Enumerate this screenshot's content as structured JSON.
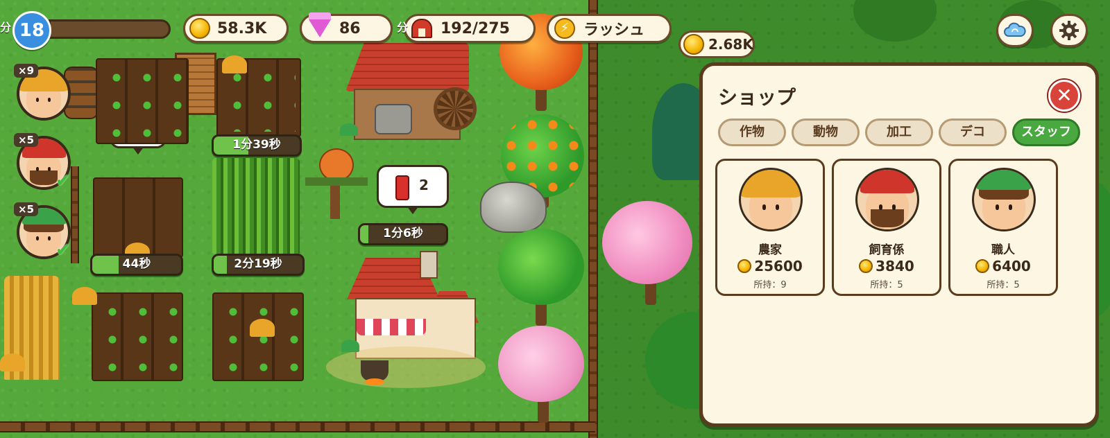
{
  "hud": {
    "level": "18",
    "coins": "58.3K",
    "gems": "86",
    "barn_capacity": "192/275",
    "rush_label": "ラッシュ",
    "cloud_icon": "cloud-sync-icon",
    "settings_icon": "gear-icon"
  },
  "farm": {
    "timers": [
      {
        "label": "1分39秒",
        "progress": 0.4
      },
      {
        "label": "1分6秒",
        "progress": 0.1
      },
      {
        "label": "44秒",
        "progress": 0.3
      },
      {
        "label": "2分19秒",
        "progress": 0.15
      }
    ],
    "sauce_bubble_count": "2",
    "floating_coin": "2.68K",
    "left_edge_text_1": "分",
    "left_edge_text_2": "分"
  },
  "staff_list": [
    {
      "count": "×9",
      "type": "farmer",
      "ready": false
    },
    {
      "count": "×5",
      "type": "keeper",
      "ready": true
    },
    {
      "count": "×5",
      "type": "artisan",
      "ready": true
    }
  ],
  "shop": {
    "title": "ショップ",
    "tabs": [
      "作物",
      "動物",
      "加工",
      "デコ",
      "スタッフ"
    ],
    "active_tab": "スタッフ",
    "items": [
      {
        "name": "農家",
        "price": "25600",
        "owned": "所持：9"
      },
      {
        "name": "飼育係",
        "price": "3840",
        "owned": "所持：5"
      },
      {
        "name": "職人",
        "price": "6400",
        "owned": "所持：5"
      }
    ]
  },
  "colors": {
    "accent_green": "#4aa840",
    "close_red": "#d8433a",
    "panel_cream": "#fdf6e3",
    "border_brown": "#5a3b1e"
  }
}
